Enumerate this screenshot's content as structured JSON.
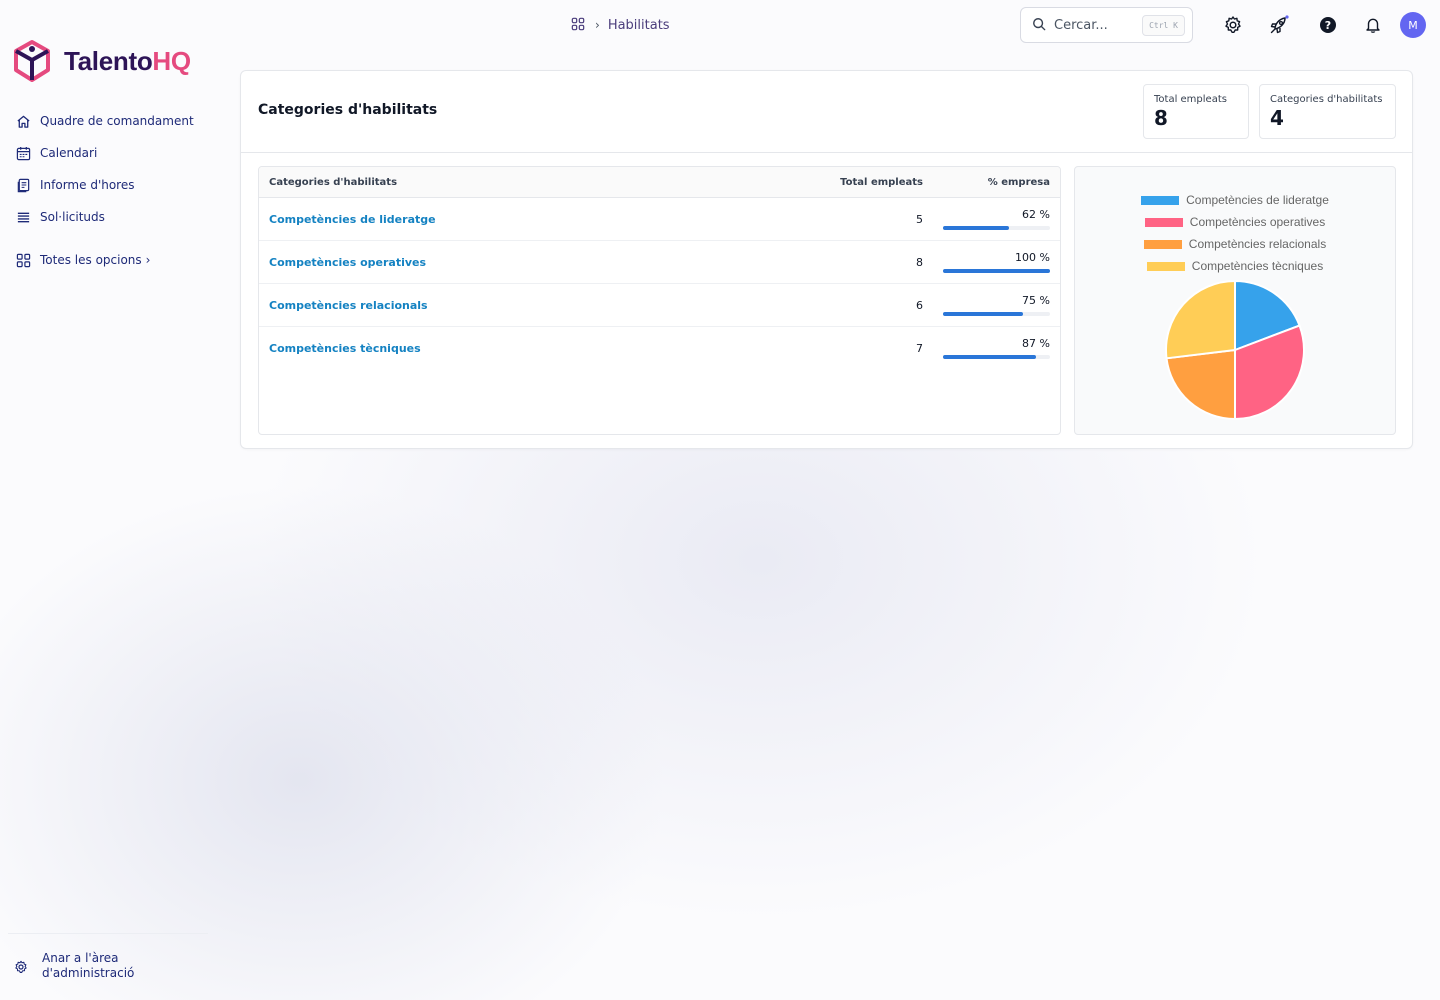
{
  "brand": {
    "name_part1": "Talento",
    "name_part2": "HQ"
  },
  "sidebar": {
    "items": [
      {
        "label": "Quadre de comandament",
        "icon": "home-icon"
      },
      {
        "label": "Calendari",
        "icon": "calendar-icon"
      },
      {
        "label": "Informe d'hores",
        "icon": "report-icon"
      },
      {
        "label": "Sol·licituds",
        "icon": "list-icon"
      }
    ],
    "all_options": {
      "label": "Totes les opcions",
      "icon": "grid-icon"
    },
    "admin": {
      "label": "Anar a l'àrea d'administració",
      "icon": "gear-icon"
    }
  },
  "topbar": {
    "breadcrumb": {
      "current": "Habilitats"
    },
    "search": {
      "placeholder": "Cercar...",
      "shortcut": "Ctrl K"
    },
    "avatar_initial": "M"
  },
  "page": {
    "title": "Categories d'habilitats",
    "stats": [
      {
        "label": "Total empleats",
        "value": "8"
      },
      {
        "label": "Categories d'habilitats",
        "value": "4"
      }
    ],
    "table": {
      "headers": {
        "category": "Categories d'habilitats",
        "total": "Total empleats",
        "percent": "% empresa"
      },
      "rows": [
        {
          "name": "Competències de lideratge",
          "total": "5",
          "percent_label": "62 %",
          "percent": 62
        },
        {
          "name": "Competències operatives",
          "total": "8",
          "percent_label": "100 %",
          "percent": 100
        },
        {
          "name": "Competències relacionals",
          "total": "6",
          "percent_label": "75 %",
          "percent": 75
        },
        {
          "name": "Competències tècniques",
          "total": "7",
          "percent_label": "87 %",
          "percent": 87
        }
      ]
    }
  },
  "colors": {
    "accent": "#1482c2",
    "bar": "#2a76d8",
    "series": [
      "#36a2eb",
      "#ff6384",
      "#ff9f40",
      "#ffcd56"
    ]
  },
  "chart_data": {
    "type": "pie",
    "categories": [
      "Competències de lideratge",
      "Competències operatives",
      "Competències relacionals",
      "Competències tècniques"
    ],
    "values": [
      5,
      8,
      6,
      7
    ],
    "legend": "top"
  }
}
